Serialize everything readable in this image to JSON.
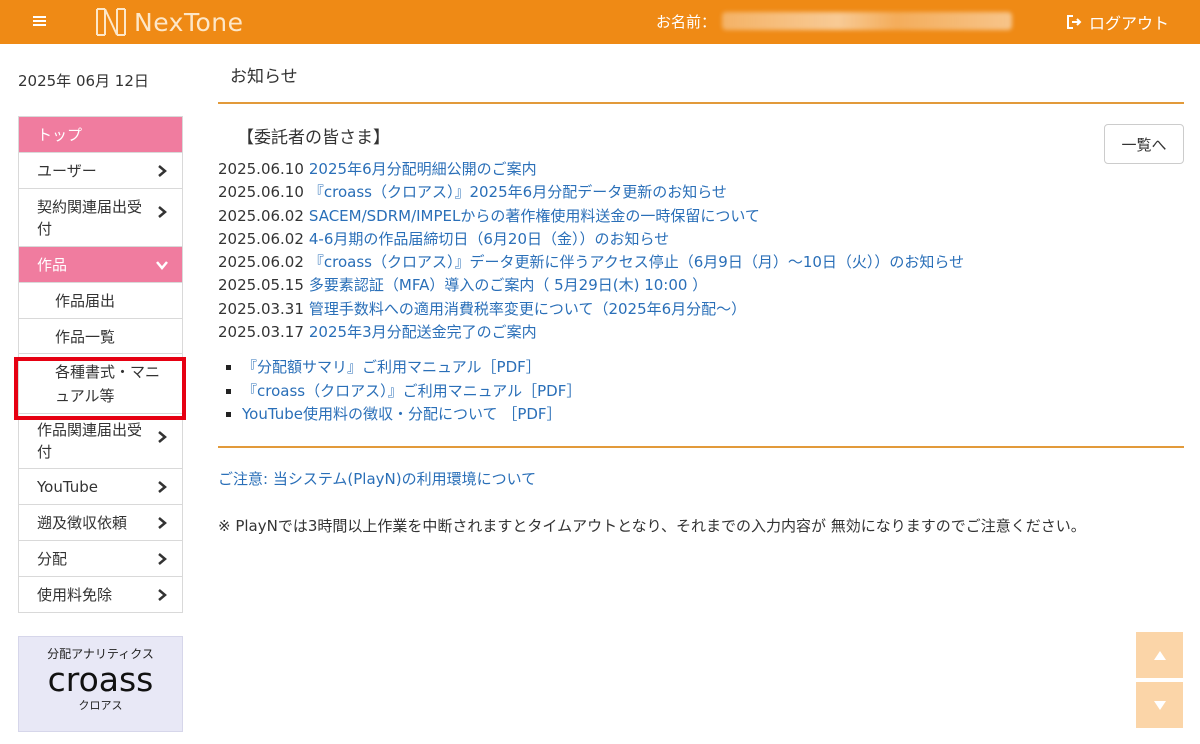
{
  "header": {
    "logo_text": "NexTone",
    "name_label": "お名前：",
    "logout_label": "ログアウト"
  },
  "sidebar": {
    "date": "2025年 06月 12日",
    "items": [
      {
        "label": "トップ"
      },
      {
        "label": "ユーザー"
      },
      {
        "label": "契約関連届出受付"
      },
      {
        "label": "作品"
      },
      {
        "label": "作品届出"
      },
      {
        "label": "作品一覧"
      },
      {
        "label": "各種書式・マニュアル等"
      },
      {
        "label": "作品関連届出受付"
      },
      {
        "label": "YouTube"
      },
      {
        "label": "遡及徴収依頼"
      },
      {
        "label": "分配"
      },
      {
        "label": "使用料免除"
      }
    ],
    "croass": {
      "caption": "分配アナリティクス",
      "logo": "croass",
      "reading": "クロアス"
    }
  },
  "main": {
    "page_title": "お知らせ",
    "section_title": "【委託者の皆さま】",
    "list_button": "一覧へ",
    "news": [
      {
        "date": "2025.06.10",
        "title": "2025年6月分配明細公開のご案内"
      },
      {
        "date": "2025.06.10",
        "title": "『croass（クロアス）』2025年6月分配データ更新のお知らせ"
      },
      {
        "date": "2025.06.02",
        "title": "SACEM/SDRM/IMPELからの著作権使用料送金の一時保留について"
      },
      {
        "date": "2025.06.02",
        "title": "4-6月期の作品届締切日（6月20日（金））のお知らせ"
      },
      {
        "date": "2025.06.02",
        "title": "『croass（クロアス）』データ更新に伴うアクセス停止（6月9日（月）～10日（火））のお知らせ"
      },
      {
        "date": "2025.05.15",
        "title": "多要素認証（MFA）導入のご案内（ 5月29日(木) 10:00 ）"
      },
      {
        "date": "2025.03.31",
        "title": "管理手数料への適用消費税率変更について（2025年6月分配～）"
      },
      {
        "date": "2025.03.17",
        "title": "2025年3月分配送金完了のご案内"
      }
    ],
    "manuals": [
      {
        "label": "『分配額サマリ』ご利用マニュアル［PDF］"
      },
      {
        "label": "『croass（クロアス）』ご利用マニュアル［PDF］"
      },
      {
        "label": "YouTube使用料の徴収・分配について ［PDF］"
      }
    ],
    "notice_link": "ご注意: 当システム(PlayN)の利用環境について",
    "warning": "※ PlayNでは3時間以上作業を中断されますとタイムアウトとなり、それまでの入力内容が 無効になりますのでご注意ください。"
  },
  "colors": {
    "header": "#ef8a15",
    "menu_active": "#f07c9f",
    "link": "#2a6fb8",
    "rule": "#e29a3a",
    "highlight": "#e60012"
  }
}
